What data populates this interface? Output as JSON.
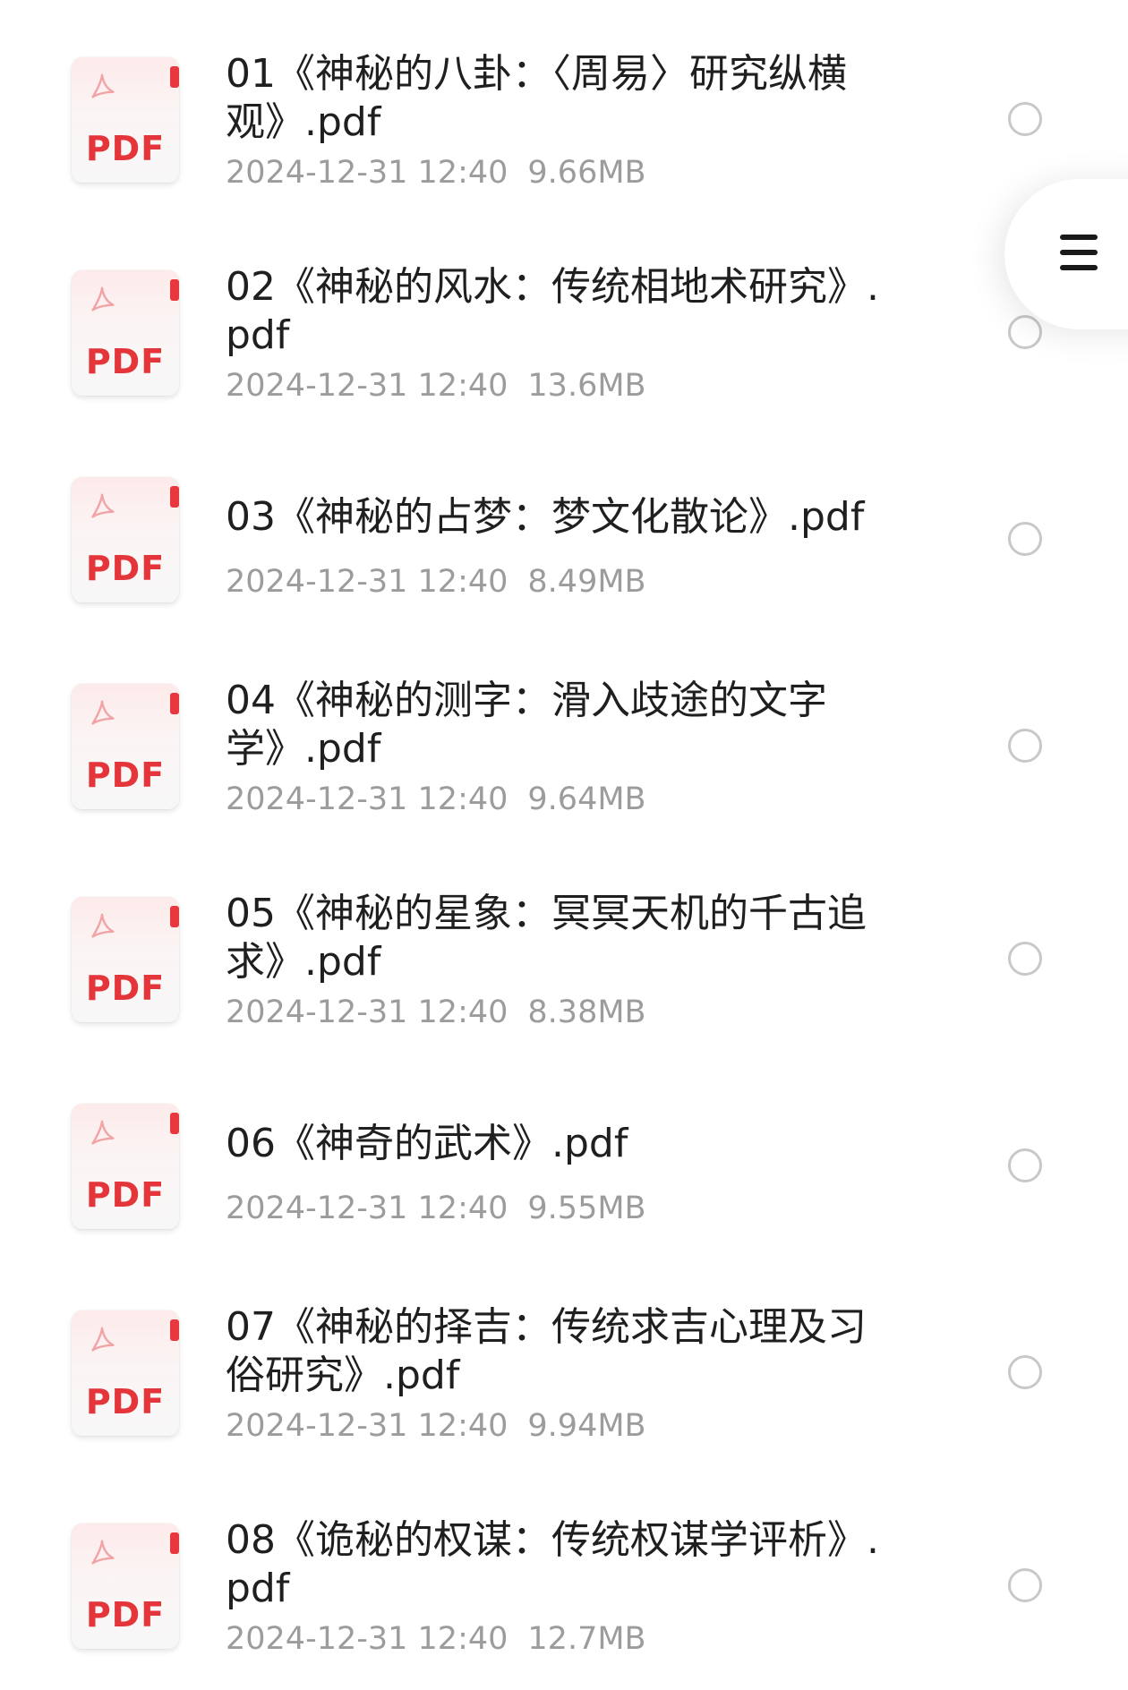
{
  "file_type_label": "PDF",
  "files": [
    {
      "name": "01《神秘的八卦：〈周易〉研究纵横观》.pdf",
      "date": "2024-12-31 12:40",
      "size": "9.66MB",
      "selected": false
    },
    {
      "name": "02《神秘的风水：传统相地术研究》.pdf",
      "date": "2024-12-31 12:40",
      "size": "13.6MB",
      "selected": false
    },
    {
      "name": "03《神秘的占梦：梦文化散论》.pdf",
      "date": "2024-12-31 12:40",
      "size": "8.49MB",
      "selected": false
    },
    {
      "name": "04《神秘的测字：滑入歧途的文字学》.pdf",
      "date": "2024-12-31 12:40",
      "size": "9.64MB",
      "selected": false
    },
    {
      "name": "05《神秘的星象：冥冥天机的千古追求》.pdf",
      "date": "2024-12-31 12:40",
      "size": "8.38MB",
      "selected": false
    },
    {
      "name": "06《神奇的武术》.pdf",
      "date": "2024-12-31 12:40",
      "size": "9.55MB",
      "selected": false
    },
    {
      "name": "07《神秘的择吉：传统求吉心理及习俗研究》.pdf",
      "date": "2024-12-31 12:40",
      "size": "9.94MB",
      "selected": false
    },
    {
      "name": "08《诡秘的权谋：传统权谋学评析》.pdf",
      "date": "2024-12-31 12:40",
      "size": "12.7MB",
      "selected": false
    }
  ],
  "floating_menu": {
    "icon": "menu-icon"
  },
  "colors": {
    "pdf_red": "#e4353a",
    "title_text": "#1f1f1f",
    "meta_text": "#9c9c9c",
    "radio_border": "#c8c8c8"
  }
}
